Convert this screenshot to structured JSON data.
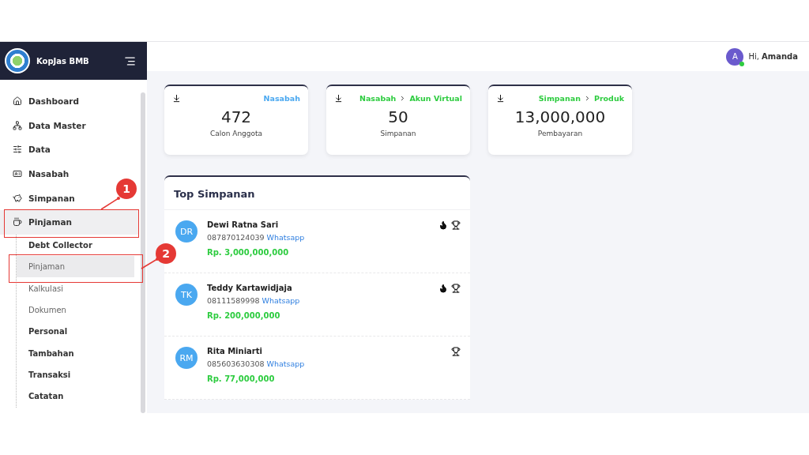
{
  "sidebar": {
    "brand": "KopJas BMB",
    "items": [
      {
        "label": "Dashboard",
        "selected": false
      },
      {
        "label": "Data Master",
        "selected": false
      },
      {
        "label": "Data",
        "selected": false
      },
      {
        "label": "Nasabah",
        "selected": false
      },
      {
        "label": "Simpanan",
        "selected": false
      },
      {
        "label": "Pinjaman",
        "selected": true,
        "children": [
          {
            "label": "Debt Collector",
            "bold": true,
            "selected": false
          },
          {
            "label": "Pinjaman",
            "bold": false,
            "selected": true
          },
          {
            "label": "Kalkulasi",
            "bold": false,
            "selected": false
          },
          {
            "label": "Dokumen",
            "bold": false,
            "selected": false
          },
          {
            "label": "Personal",
            "bold": true,
            "selected": false
          },
          {
            "label": "Tambahan",
            "bold": true,
            "selected": false
          },
          {
            "label": "Transaksi",
            "bold": true,
            "selected": false
          },
          {
            "label": "Catatan",
            "bold": true,
            "selected": false
          }
        ]
      }
    ]
  },
  "topbar": {
    "avatar": "A",
    "greeting": "Hi,",
    "user": "Amanda",
    "online": true
  },
  "stats": [
    {
      "breadcrumb": [
        "Nasabah"
      ],
      "color": "#4aa8f0",
      "value": "472",
      "label": "Calon Anggota"
    },
    {
      "breadcrumb": [
        "Nasabah",
        "Akun Virtual"
      ],
      "color": "#2ecc40",
      "value": "50",
      "label": "Simpanan"
    },
    {
      "breadcrumb": [
        "Simpanan",
        "Produk"
      ],
      "color": "#2ecc40",
      "value": "13,000,000",
      "label": "Pembayaran"
    }
  ],
  "top_simpanan": {
    "title": "Top Simpanan",
    "rows": [
      {
        "initials": "DR",
        "name": "Dewi Ratna Sari",
        "phone": "087870124039",
        "link": "Whatsapp",
        "amount": "Rp. 3,000,000,000",
        "hot": true
      },
      {
        "initials": "TK",
        "name": "Teddy Kartawidjaja",
        "phone": "08111589998",
        "link": "Whatsapp",
        "amount": "Rp. 200,000,000",
        "hot": true
      },
      {
        "initials": "RM",
        "name": "Rita Miniarti",
        "phone": "085603630308",
        "link": "Whatsapp",
        "amount": "Rp. 77,000,000",
        "hot": false
      }
    ]
  },
  "annotations": [
    {
      "number": "1"
    },
    {
      "number": "2"
    }
  ]
}
